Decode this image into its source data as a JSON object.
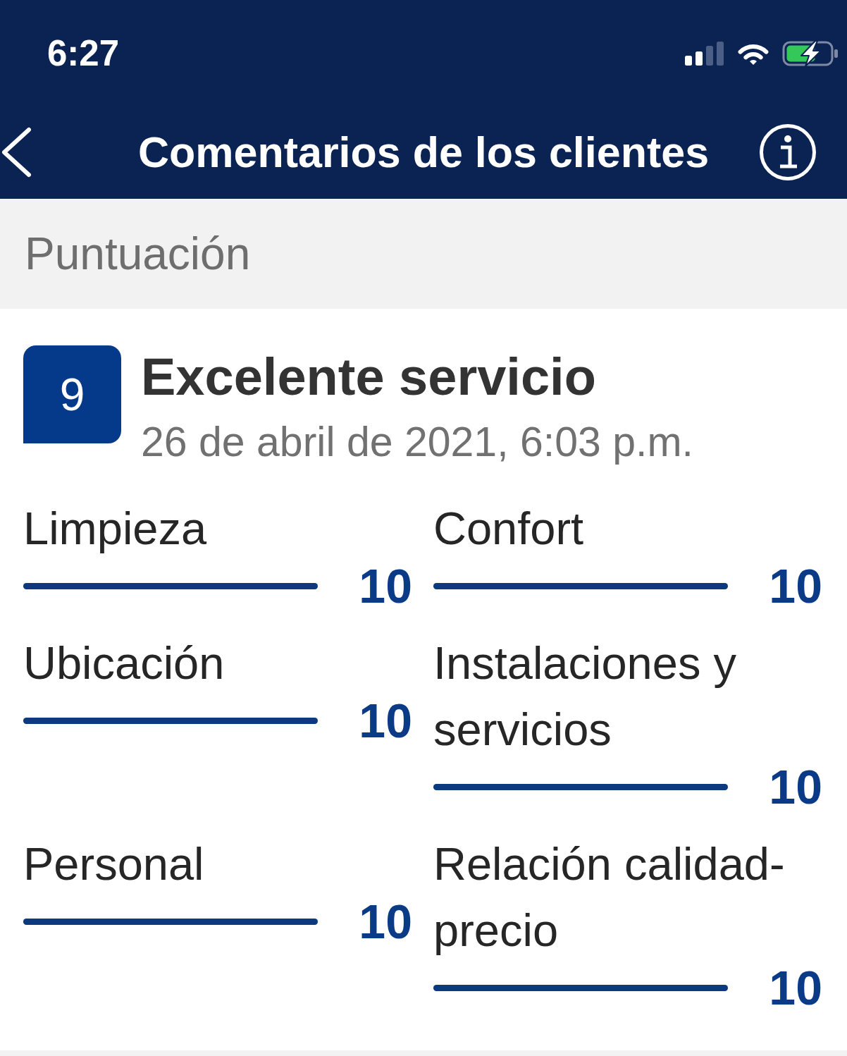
{
  "status_bar": {
    "time": "6:27"
  },
  "nav_bar": {
    "title": "Comentarios de los clientes"
  },
  "section": {
    "title": "Puntuación"
  },
  "review": {
    "score": "9",
    "headline": "Excelente servicio",
    "date": "26 de abril de 2021, 6:03 p.m."
  },
  "ratings": [
    {
      "category": "Limpieza",
      "level": 1,
      "score": "10"
    },
    {
      "category": "Confort",
      "level": 1,
      "score": "10"
    },
    {
      "category": "Ubicación",
      "level": 1,
      "score": "10"
    },
    {
      "category": "Instalaciones y servicios",
      "level": 1,
      "score": "10"
    },
    {
      "category": "Personal",
      "level": 1,
      "score": "10"
    },
    {
      "category": "Relación calidad-precio",
      "level": 1,
      "score": "10"
    }
  ]
}
